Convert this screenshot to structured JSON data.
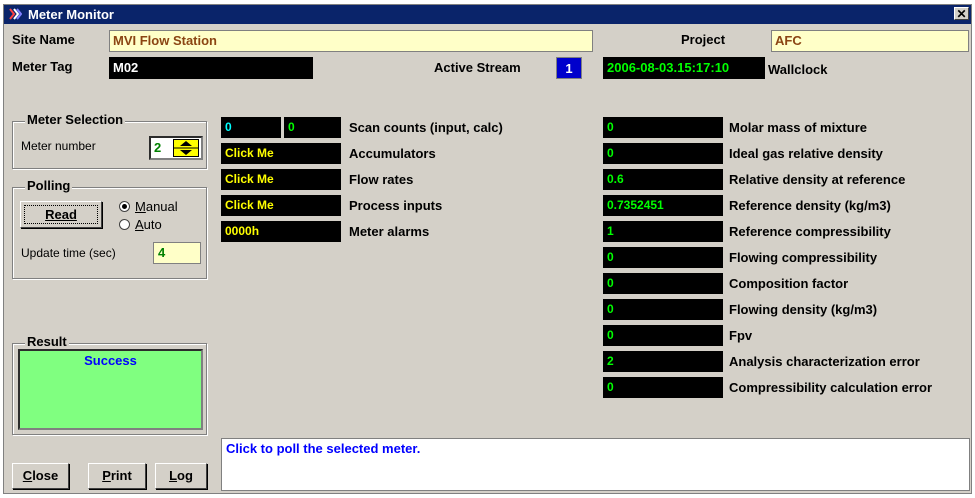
{
  "window": {
    "title": "Meter Monitor",
    "close_glyph": "✕"
  },
  "header": {
    "site_name_label": "Site Name",
    "site_name_value": "MVI Flow Station",
    "project_label": "Project",
    "project_value": "AFC",
    "meter_tag_label": "Meter Tag",
    "meter_tag_value": "M02",
    "active_stream_label": "Active Stream",
    "active_stream_value": "1",
    "wallclock_value": "2006-08-03.15:17:10",
    "wallclock_label": "Wallclock"
  },
  "meter_selection": {
    "title": "Meter Selection",
    "meter_number_label": "Meter number",
    "meter_number_value": "2"
  },
  "polling": {
    "title": "Polling",
    "read_label": "Read",
    "manual_label": "Manual",
    "auto_label": "Auto",
    "selected_mode": "Manual",
    "update_time_label": "Update time (sec)",
    "update_time_value": "4"
  },
  "result": {
    "title": "Result",
    "text": "Success"
  },
  "buttons": {
    "close": "Close",
    "print": "Print",
    "log": "Log"
  },
  "status_message": "Click to poll the selected meter.",
  "middle_rows": [
    {
      "label": "Scan counts (input, calc)",
      "input": "0",
      "calc": "0"
    },
    {
      "label": "Accumulators",
      "value": "Click Me"
    },
    {
      "label": "Flow rates",
      "value": "Click Me"
    },
    {
      "label": "Process inputs",
      "value": "Click Me"
    },
    {
      "label": "Meter alarms",
      "value": "0000h"
    }
  ],
  "right_rows": [
    {
      "value": "0",
      "label": "Molar mass of mixture"
    },
    {
      "value": "0",
      "label": "Ideal gas relative density"
    },
    {
      "value": "0.6",
      "label": "Relative density at reference"
    },
    {
      "value": "0.7352451",
      "label": "Reference density (kg/m3)"
    },
    {
      "value": "1",
      "label": "Reference compressibility"
    },
    {
      "value": "0",
      "label": "Flowing compressibility"
    },
    {
      "value": "0",
      "label": "Composition factor"
    },
    {
      "value": "0",
      "label": "Flowing density (kg/m3)"
    },
    {
      "value": "0",
      "label": "Fpv"
    },
    {
      "value": "2",
      "label": "Analysis characterization error"
    },
    {
      "value": "0",
      "label": "Compressibility calculation error"
    }
  ],
  "colors": {
    "title_bar": "#0a246a",
    "field_yellow": "#ffffc8",
    "value_green": "#00ff00",
    "value_cyan": "#00ffff",
    "value_yellow": "#ffff00",
    "result_bg": "#80ff80",
    "stream_blue": "#0000cc"
  }
}
